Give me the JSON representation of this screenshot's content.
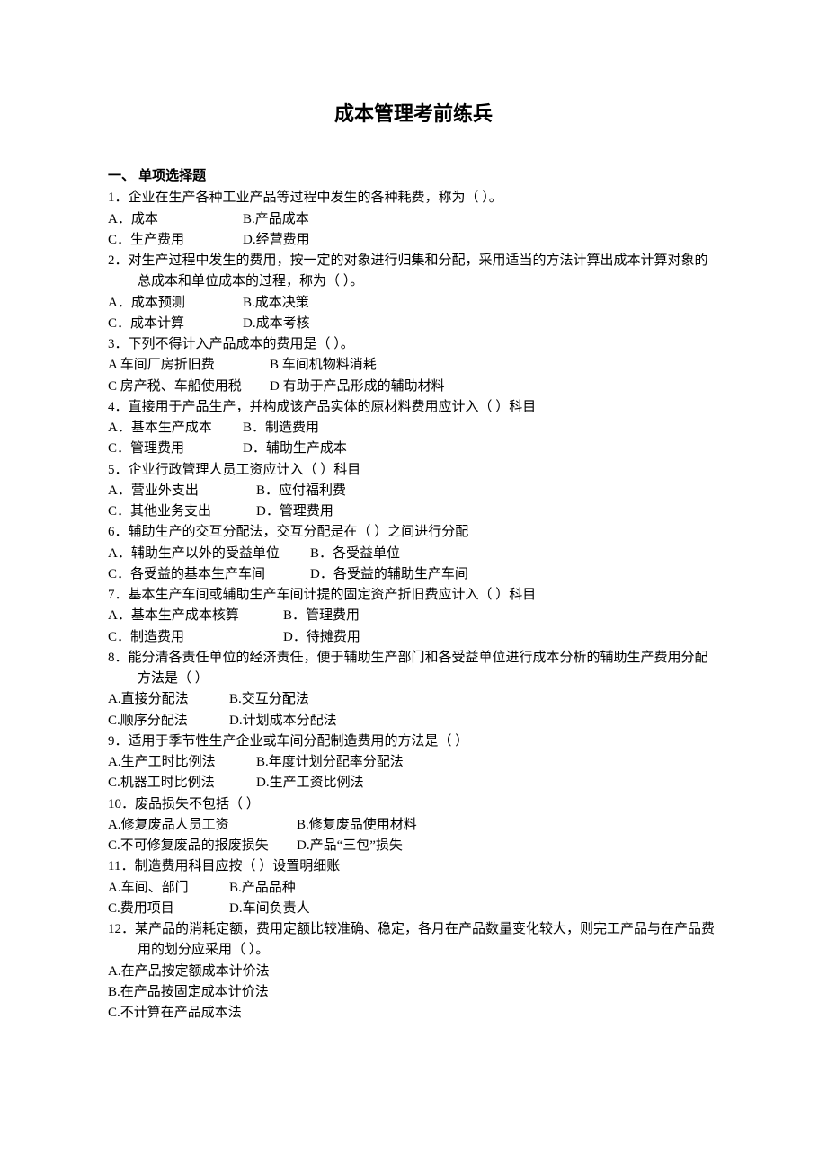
{
  "title": "成本管理考前练兵",
  "section_heading": "一、 单项选择题",
  "questions": [
    {
      "num": "1．",
      "stem": "企业在生产各种工业产品等过程中发生的各种耗费，称为（ ）。",
      "opt_rows": [
        [
          {
            "t": "A．成本",
            "w": "10em"
          },
          {
            "t": "B.产品成本"
          }
        ],
        [
          {
            "t": "C．生产费用",
            "w": "10em"
          },
          {
            "t": "D.经营费用"
          }
        ]
      ]
    },
    {
      "num": "2．",
      "stem": "对生产过程中发生的费用，按一定的对象进行归集和分配，采用适当的方法计算出成本计算对象的总成本和单位成本的过程，称为（ ）。",
      "stem_wrap": true,
      "opt_rows": [
        [
          {
            "t": "A．成本预测",
            "w": "10em"
          },
          {
            "t": "B.成本决策"
          }
        ],
        [
          {
            "t": "C．成本计算",
            "w": "10em"
          },
          {
            "t": "D.成本考核"
          }
        ]
      ]
    },
    {
      "num": "3．",
      "stem": "下列不得计入产品成本的费用是（ ）。",
      "opt_rows": [
        [
          {
            "t": "A 车间厂房折旧费",
            "w": "12em"
          },
          {
            "t": "B 车间机物料消耗"
          }
        ],
        [
          {
            "t": "C 房产税、车船使用税",
            "w": "12em"
          },
          {
            "t": "D 有助于产品形成的辅助材料"
          }
        ]
      ]
    },
    {
      "num": "4．",
      "stem": "直接用于产品生产，并构成该产品实体的原材料费用应计入（ ）科目",
      "opt_rows": [
        [
          {
            "t": "A．基本生产成本",
            "w": "10em"
          },
          {
            "t": "B．制造费用"
          }
        ],
        [
          {
            "t": "C．管理费用",
            "w": "10em"
          },
          {
            "t": "D．辅助生产成本"
          }
        ]
      ]
    },
    {
      "num": "5．",
      "stem": "企业行政管理人员工资应计入（ ）科目",
      "opt_rows": [
        [
          {
            "t": "A．营业外支出",
            "w": "11em"
          },
          {
            "t": "B．应付福利费"
          }
        ],
        [
          {
            "t": "C．其他业务支出",
            "w": "11em"
          },
          {
            "t": "D．管理费用"
          }
        ]
      ]
    },
    {
      "num": "6．",
      "stem": "辅助生产的交互分配法，交互分配是在（ ）之间进行分配",
      "opt_rows": [
        [
          {
            "t": "A．辅助生产以外的受益单位",
            "w": "15em"
          },
          {
            "t": "B．各受益单位"
          }
        ],
        [
          {
            "t": "C．各受益的基本生产车间",
            "w": "15em"
          },
          {
            "t": "D．各受益的辅助生产车间"
          }
        ]
      ]
    },
    {
      "num": "7．",
      "stem": "基本生产车间或辅助生产车间计提的固定资产折旧费应计入（ ）科目",
      "opt_rows": [
        [
          {
            "t": "A．基本生产成本核算",
            "w": "13em"
          },
          {
            "t": "B．管理费用"
          }
        ],
        [
          {
            "t": "C．制造费用",
            "w": "13em"
          },
          {
            "t": "D．待摊费用"
          }
        ]
      ]
    },
    {
      "num": "8．",
      "stem": "能分清各责任单位的经济责任，便于辅助生产部门和各受益单位进行成本分析的辅助生产费用分配方法是（ ）",
      "stem_wrap": true,
      "opt_rows": [
        [
          {
            "t": "A.直接分配法",
            "w": "9em"
          },
          {
            "t": "B.交互分配法"
          }
        ],
        [
          {
            "t": "C.顺序分配法",
            "w": "9em"
          },
          {
            "t": "D.计划成本分配法"
          }
        ]
      ]
    },
    {
      "num": "9．",
      "stem": "适用于季节性生产企业或车间分配制造费用的方法是（ ）",
      "opt_rows": [
        [
          {
            "t": "A.生产工时比例法",
            "w": "11em"
          },
          {
            "t": "B.年度计划分配率分配法"
          }
        ],
        [
          {
            "t": "C.机器工时比例法",
            "w": "11em"
          },
          {
            "t": "D.生产工资比例法"
          }
        ]
      ]
    },
    {
      "num": "10．",
      "stem": "废品损失不包括（ ）",
      "opt_rows": [
        [
          {
            "t": "A.修复废品人员工资",
            "w": "14em"
          },
          {
            "t": "B.修复废品使用材料"
          }
        ],
        [
          {
            "t": "C.不可修复废品的报废损失",
            "w": "14em"
          },
          {
            "t": "D.产品“三包”损失"
          }
        ]
      ]
    },
    {
      "num": "11．",
      "stem": "制造费用科目应按（ ）设置明细账",
      "opt_rows": [
        [
          {
            "t": "A.车间、部门",
            "w": "9em"
          },
          {
            "t": "B.产品品种"
          }
        ],
        [
          {
            "t": "C.费用项目",
            "w": "9em"
          },
          {
            "t": "D.车间负责人"
          }
        ]
      ]
    },
    {
      "num": "12．",
      "stem": "某产品的消耗定额，费用定额比较准确、稳定，各月在产品数量变化较大，则完工产品与在产品费用的划分应采用（ ）。",
      "stem_wrap": true,
      "opt_rows": [
        [
          {
            "t": "A.在产品按定额成本计价法"
          }
        ],
        [
          {
            "t": "B.在产品按固定成本计价法"
          }
        ],
        [
          {
            "t": "C.不计算在产品成本法"
          }
        ]
      ]
    }
  ]
}
